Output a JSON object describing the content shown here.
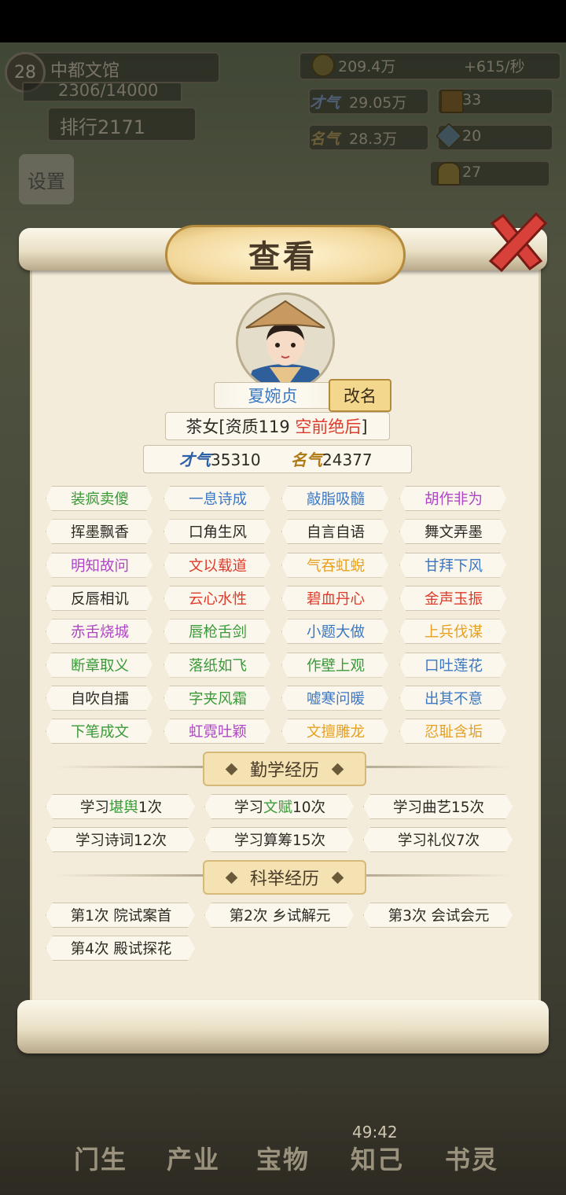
{
  "hud": {
    "level": "28",
    "location": "中都文馆",
    "progress": "2306/14000",
    "progress_fraction": 0.165,
    "rank": "排行2171",
    "silver": "209.4万",
    "silver_rate": "+615/秒",
    "talent": "29.05万",
    "fame": "28.3万",
    "item_a": "33",
    "item_b": "20",
    "gold": "27",
    "settings_label": "设置"
  },
  "dialog": {
    "title": "查看",
    "name": "夏婉贞",
    "rename_label": "改名",
    "role": "茶女[资质119",
    "grade": "空前绝后",
    "grade_suffix": "]",
    "talent_value": "35310",
    "fame_value": "24377",
    "talent_label": "才气",
    "fame_label": "名气"
  },
  "traits": [
    {
      "text": "装疯卖傻",
      "color": "#3a9a3a"
    },
    {
      "text": "一息诗成",
      "color": "#3b78c4"
    },
    {
      "text": "敲脂吸髓",
      "color": "#3b78c4"
    },
    {
      "text": "胡作非为",
      "color": "#b044c8"
    },
    {
      "text": "挥墨飘香",
      "color": "#2d2a25"
    },
    {
      "text": "口角生风",
      "color": "#2d2a25"
    },
    {
      "text": "自言自语",
      "color": "#2d2a25"
    },
    {
      "text": "舞文弄墨",
      "color": "#2d2a25"
    },
    {
      "text": "明知故问",
      "color": "#b044c8"
    },
    {
      "text": "文以载道",
      "color": "#e03a2a"
    },
    {
      "text": "气吞虹蜺",
      "color": "#e8a020"
    },
    {
      "text": "甘拜下风",
      "color": "#3b78c4"
    },
    {
      "text": "反唇相讥",
      "color": "#2d2a25"
    },
    {
      "text": "云心水性",
      "color": "#e03a2a"
    },
    {
      "text": "碧血丹心",
      "color": "#e03a2a"
    },
    {
      "text": "金声玉振",
      "color": "#e03a2a"
    },
    {
      "text": "赤舌烧城",
      "color": "#b044c8"
    },
    {
      "text": "唇枪舌剑",
      "color": "#3a9a3a"
    },
    {
      "text": "小题大做",
      "color": "#3b78c4"
    },
    {
      "text": "上兵伐谋",
      "color": "#e8a020"
    },
    {
      "text": "断章取义",
      "color": "#3a9a3a"
    },
    {
      "text": "落纸如飞",
      "color": "#3a9a3a"
    },
    {
      "text": "作壁上观",
      "color": "#3a9a3a"
    },
    {
      "text": "口吐莲花",
      "color": "#3b78c4"
    },
    {
      "text": "自吹自擂",
      "color": "#2d2a25"
    },
    {
      "text": "字夹风霜",
      "color": "#3a9a3a"
    },
    {
      "text": "嘘寒问暖",
      "color": "#3b78c4"
    },
    {
      "text": "出其不意",
      "color": "#3b78c4"
    },
    {
      "text": "下笔成文",
      "color": "#3a9a3a"
    },
    {
      "text": "虹霓吐颖",
      "color": "#b044c8"
    },
    {
      "text": "文擅雕龙",
      "color": "#e8a020"
    },
    {
      "text": "忍耻含垢",
      "color": "#e8a020"
    }
  ],
  "study": {
    "title": "勤学经历",
    "items": [
      {
        "prefix": "学习",
        "subject": "堪舆",
        "suffix": "1次",
        "subject_color": "#3a9a3a"
      },
      {
        "prefix": "学习",
        "subject": "文赋",
        "suffix": "10次",
        "subject_color": "#3a9a3a"
      },
      {
        "prefix": "学习",
        "subject": "曲艺",
        "suffix": "15次",
        "subject_color": "#2d2a25"
      },
      {
        "prefix": "学习",
        "subject": "诗词",
        "suffix": "12次",
        "subject_color": "#2d2a25"
      },
      {
        "prefix": "学习",
        "subject": "算筹",
        "suffix": "15次",
        "subject_color": "#2d2a25"
      },
      {
        "prefix": "学习",
        "subject": "礼仪",
        "suffix": "7次",
        "subject_color": "#2d2a25"
      }
    ]
  },
  "exam": {
    "title": "科举经历",
    "items": [
      "第1次 院试案首",
      "第2次 乡试解元",
      "第3次 会试会元",
      "第4次 殿试探花"
    ]
  },
  "nav": {
    "items": [
      "门生",
      "产业",
      "宝物",
      "知己",
      "书灵"
    ],
    "timer": "49:42"
  }
}
